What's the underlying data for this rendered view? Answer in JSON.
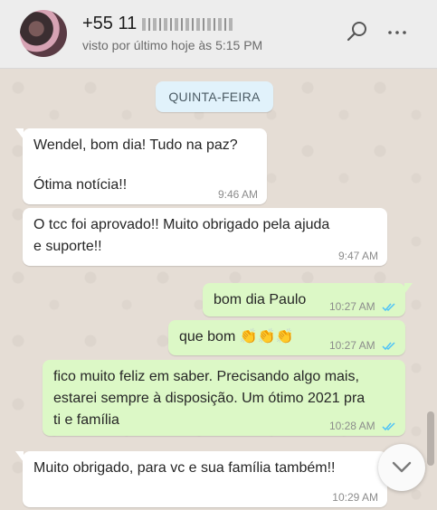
{
  "header": {
    "contact_name": "+55 11",
    "last_seen": "visto por último hoje às 5:15 PM",
    "search_icon": "search-icon",
    "menu_icon": "more-vertical-icon"
  },
  "chat": {
    "date_chip": "QUINTA-FEIRA",
    "messages": [
      {
        "direction": "in",
        "lines": [
          "Wendel, bom dia! Tudo na paz?",
          "",
          "Ótima notícia!!"
        ],
        "time": "9:46 AM"
      },
      {
        "direction": "in",
        "lines": [
          "O tcc foi aprovado!! Muito obrigado pela ajuda",
          "e suporte!!"
        ],
        "time": "9:47 AM"
      },
      {
        "direction": "out",
        "lines": [
          "bom dia Paulo"
        ],
        "time": "10:27 AM",
        "status": "read"
      },
      {
        "direction": "out",
        "lines": [
          "que bom 👏👏👏"
        ],
        "time": "10:27 AM",
        "status": "read"
      },
      {
        "direction": "out",
        "lines": [
          "fico muito feliz em saber. Precisando algo mais,",
          "estarei sempre à disposição. Um ótimo 2021 pra",
          "ti e família"
        ],
        "time": "10:28 AM",
        "status": "read"
      },
      {
        "direction": "in",
        "lines": [
          "Muito obrigado, para vc e sua família também!!"
        ],
        "time": "10:29 AM"
      }
    ]
  },
  "colors": {
    "chat_bg": "#e5ddd5",
    "incoming_bubble": "#ffffff",
    "outgoing_bubble": "#dcf8c6",
    "read_ticks": "#4fc3f7",
    "header_bg": "#ededed"
  }
}
